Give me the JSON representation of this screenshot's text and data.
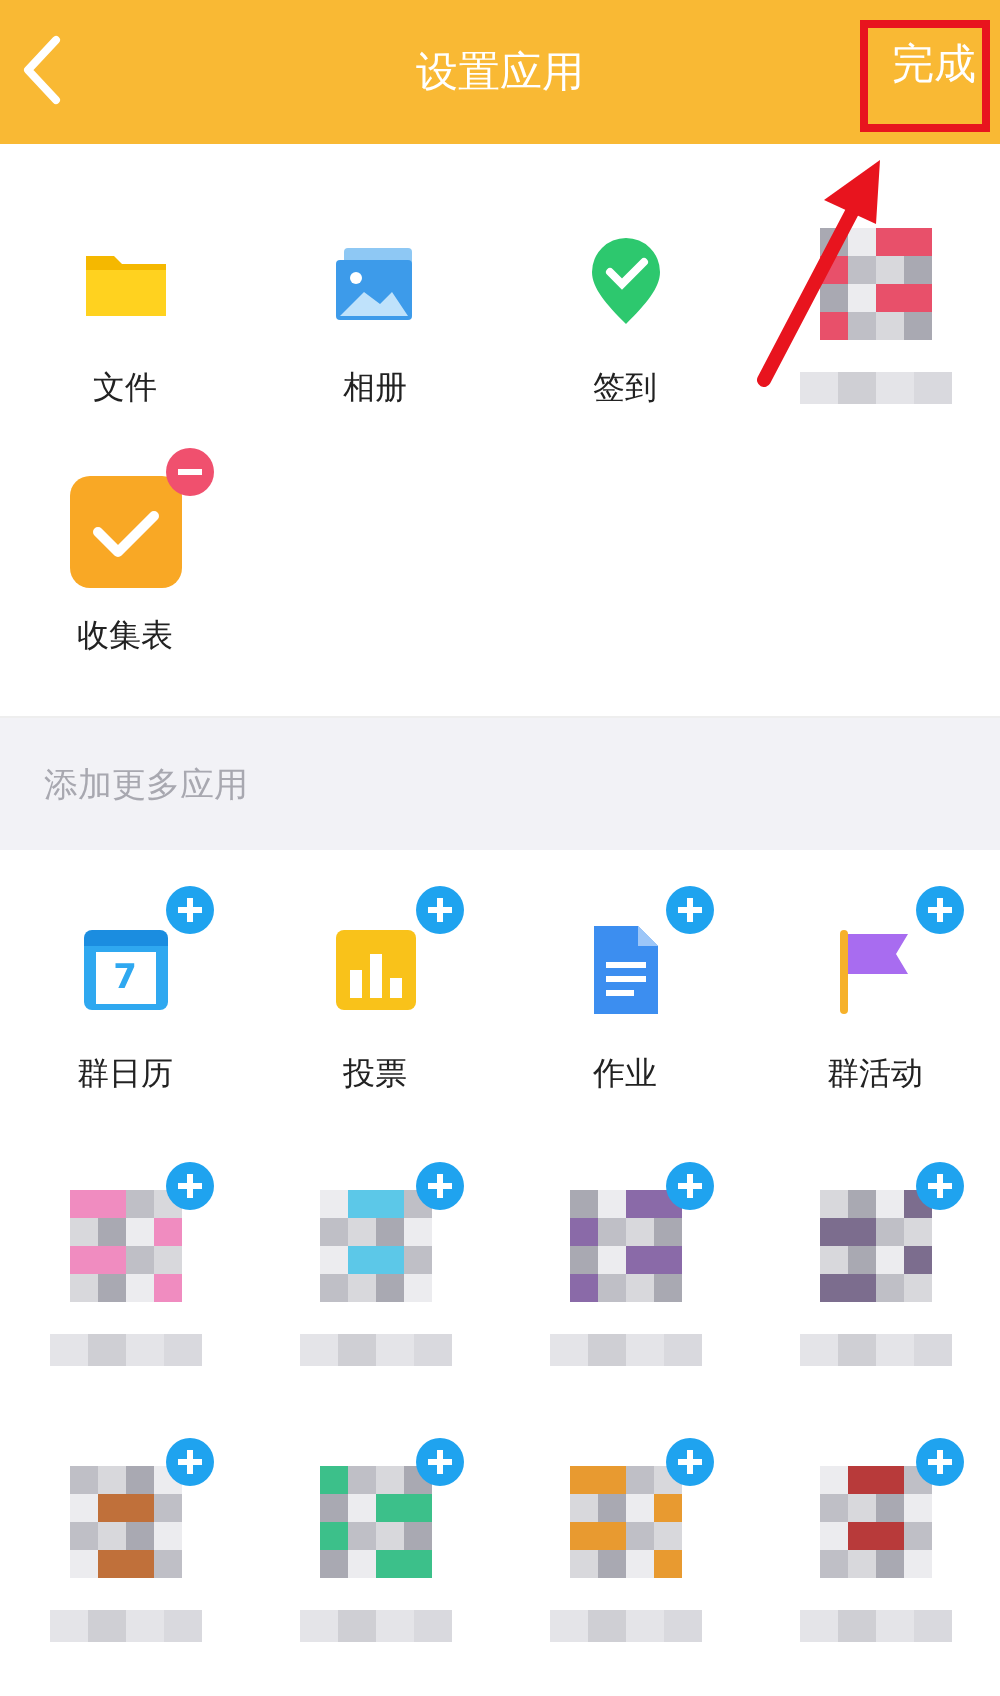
{
  "header": {
    "title": "设置应用",
    "done": "完成"
  },
  "my_apps": [
    {
      "kind": "folder",
      "label": "文件",
      "removable": false
    },
    {
      "kind": "album",
      "label": "相册",
      "removable": false
    },
    {
      "kind": "checkin",
      "label": "签到",
      "removable": false
    },
    {
      "kind": "pixelated",
      "color": "#e8506a",
      "removable": false
    },
    {
      "kind": "form",
      "label": "收集表",
      "removable": true
    }
  ],
  "more_section": {
    "title": "添加更多应用"
  },
  "more_apps": [
    {
      "kind": "calendar",
      "label": "群日历",
      "icon_text": "7"
    },
    {
      "kind": "vote",
      "label": "投票"
    },
    {
      "kind": "homework",
      "label": "作业"
    },
    {
      "kind": "flag",
      "label": "群活动"
    },
    {
      "kind": "pixelated",
      "color": "#f08cc0"
    },
    {
      "kind": "pixelated",
      "color": "#5cc8e8"
    },
    {
      "kind": "pixelated",
      "color": "#8a6aa8"
    },
    {
      "kind": "pixelated",
      "color": "#7c6d8e"
    },
    {
      "kind": "pixelated",
      "color": "#c0703a"
    },
    {
      "kind": "pixelated",
      "color": "#3cc08a"
    },
    {
      "kind": "pixelated",
      "color": "#e89a30"
    },
    {
      "kind": "pixelated",
      "color": "#b83a3a"
    }
  ]
}
